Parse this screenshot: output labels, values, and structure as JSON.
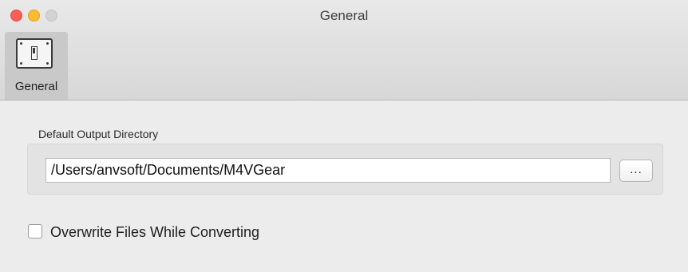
{
  "window": {
    "title": "General",
    "traffic_lights": {
      "close_color": "#fc5f57",
      "minimize_color": "#fdbc2e",
      "zoom_color": "#d3d3d3"
    }
  },
  "toolbar": {
    "tabs": [
      {
        "label": "General",
        "icon": "general-switch-icon",
        "selected": true
      }
    ]
  },
  "main": {
    "output_dir_label": "Default Output Directory",
    "output_dir_value": "/Users/anvsoft/Documents/M4VGear",
    "browse_label": "...",
    "overwrite_label": "Overwrite Files While Converting",
    "overwrite_checked": false
  }
}
